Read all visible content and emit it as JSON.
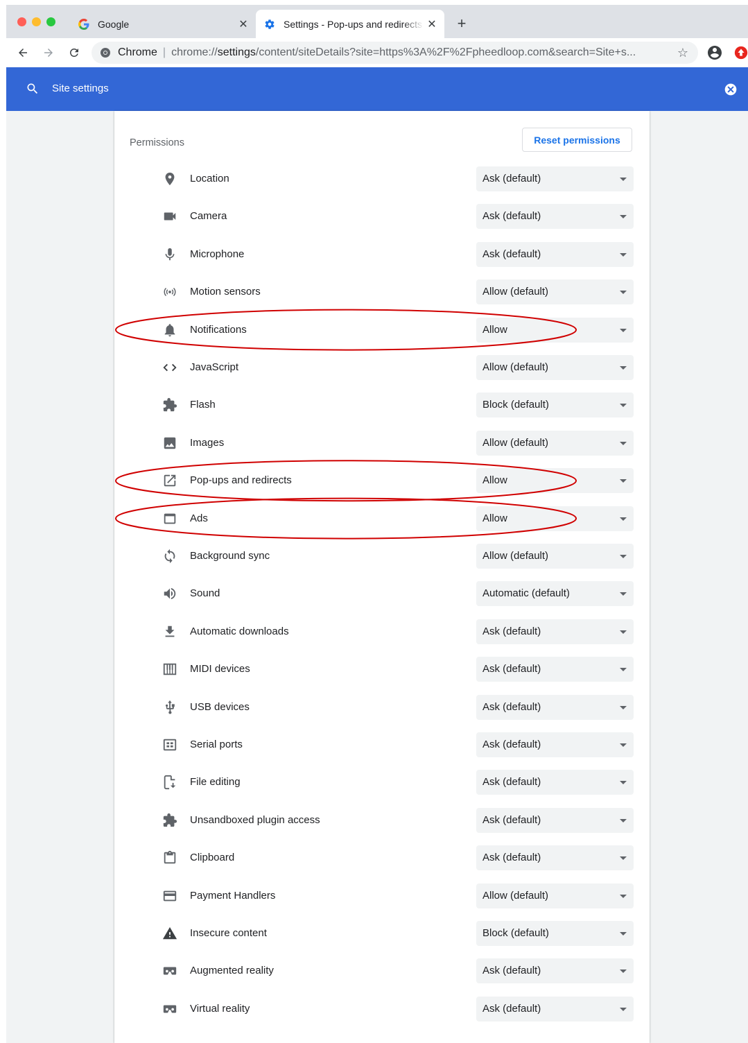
{
  "browser": {
    "tabs": [
      {
        "title": "Google",
        "icon": "google-g-icon"
      },
      {
        "title": "Settings - Pop-ups and redirects",
        "icon": "gear-icon"
      }
    ],
    "omnibox": {
      "scheme_label": "Chrome",
      "url_prefix": "chrome://",
      "url_host": "settings",
      "url_rest": "/content/siteDetails?site=https%3A%2F%2Fpheedloop.com&search=Site+s..."
    }
  },
  "header": {
    "search_label": "Site settings"
  },
  "permissions": {
    "title": "Permissions",
    "reset_label": "Reset permissions",
    "items": [
      {
        "label": "Location",
        "value": "Ask (default)",
        "icon": "location-pin-icon"
      },
      {
        "label": "Camera",
        "value": "Ask (default)",
        "icon": "camera-icon"
      },
      {
        "label": "Microphone",
        "value": "Ask (default)",
        "icon": "microphone-icon"
      },
      {
        "label": "Motion sensors",
        "value": "Allow (default)",
        "icon": "sensors-icon"
      },
      {
        "label": "Notifications",
        "value": "Allow",
        "icon": "bell-icon",
        "highlighted": true
      },
      {
        "label": "JavaScript",
        "value": "Allow (default)",
        "icon": "code-icon"
      },
      {
        "label": "Flash",
        "value": "Block (default)",
        "icon": "puzzle-icon"
      },
      {
        "label": "Images",
        "value": "Allow (default)",
        "icon": "image-icon"
      },
      {
        "label": "Pop-ups and redirects",
        "value": "Allow",
        "icon": "open-in-new-icon",
        "highlighted": true
      },
      {
        "label": "Ads",
        "value": "Allow",
        "icon": "ads-icon",
        "highlighted": true
      },
      {
        "label": "Background sync",
        "value": "Allow (default)",
        "icon": "sync-icon"
      },
      {
        "label": "Sound",
        "value": "Automatic (default)",
        "icon": "volume-icon"
      },
      {
        "label": "Automatic downloads",
        "value": "Ask (default)",
        "icon": "download-icon"
      },
      {
        "label": "MIDI devices",
        "value": "Ask (default)",
        "icon": "piano-icon"
      },
      {
        "label": "USB devices",
        "value": "Ask (default)",
        "icon": "usb-icon"
      },
      {
        "label": "Serial ports",
        "value": "Ask (default)",
        "icon": "serial-port-icon"
      },
      {
        "label": "File editing",
        "value": "Ask (default)",
        "icon": "file-edit-icon"
      },
      {
        "label": "Unsandboxed plugin access",
        "value": "Ask (default)",
        "icon": "puzzle-icon"
      },
      {
        "label": "Clipboard",
        "value": "Ask (default)",
        "icon": "clipboard-icon"
      },
      {
        "label": "Payment Handlers",
        "value": "Allow (default)",
        "icon": "credit-card-icon"
      },
      {
        "label": "Insecure content",
        "value": "Block (default)",
        "icon": "warning-icon"
      },
      {
        "label": "Augmented reality",
        "value": "Ask (default)",
        "icon": "vr-headset-icon"
      },
      {
        "label": "Virtual reality",
        "value": "Ask (default)",
        "icon": "vr-headset-icon"
      }
    ]
  },
  "colors": {
    "header_blue": "#3367d6",
    "link_blue": "#1a73e8",
    "annotation_red": "#d00000",
    "icon_gray": "#5f6368"
  }
}
